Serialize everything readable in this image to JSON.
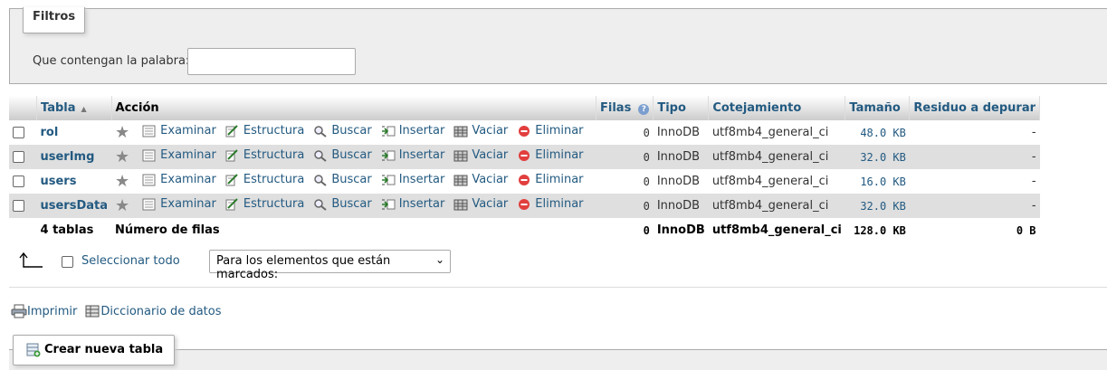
{
  "filters": {
    "legend": "Filtros",
    "label": "Que contengan la palabra:",
    "value": ""
  },
  "table": {
    "headers": {
      "tabla": "Tabla",
      "accion": "Acción",
      "filas": "Filas",
      "tipo": "Tipo",
      "cotejamiento": "Cotejamiento",
      "tamano": "Tamaño",
      "residuo": "Residuo a depurar"
    },
    "actions": {
      "examinar": "Examinar",
      "estructura": "Estructura",
      "buscar": "Buscar",
      "insertar": "Insertar",
      "vaciar": "Vaciar",
      "eliminar": "Eliminar"
    },
    "rows": [
      {
        "name": "rol",
        "rows": "0",
        "type": "InnoDB",
        "collation": "utf8mb4_general_ci",
        "size": "48.0 KB",
        "overhead": "-"
      },
      {
        "name": "userImg",
        "rows": "0",
        "type": "InnoDB",
        "collation": "utf8mb4_general_ci",
        "size": "32.0 KB",
        "overhead": "-"
      },
      {
        "name": "users",
        "rows": "0",
        "type": "InnoDB",
        "collation": "utf8mb4_general_ci",
        "size": "16.0 KB",
        "overhead": "-"
      },
      {
        "name": "usersData",
        "rows": "0",
        "type": "InnoDB",
        "collation": "utf8mb4_general_ci",
        "size": "32.0 KB",
        "overhead": "-"
      }
    ],
    "footer": {
      "count": "4 tablas",
      "label": "Número de filas",
      "rows": "0",
      "type": "InnoDB",
      "collation": "utf8mb4_general_ci",
      "size": "128.0 KB",
      "overhead": "0 B"
    }
  },
  "bulk": {
    "select_all": "Seleccionar todo",
    "dropdown_selected": "Para los elementos que están marcados:"
  },
  "links": {
    "print": "Imprimir",
    "dictionary": "Diccionario de datos"
  },
  "create": {
    "label": "Crear nueva tabla"
  },
  "colors": {
    "link": "#235a81",
    "row_even": "#dfdfdf",
    "delete_icon": "#e23e3e"
  }
}
